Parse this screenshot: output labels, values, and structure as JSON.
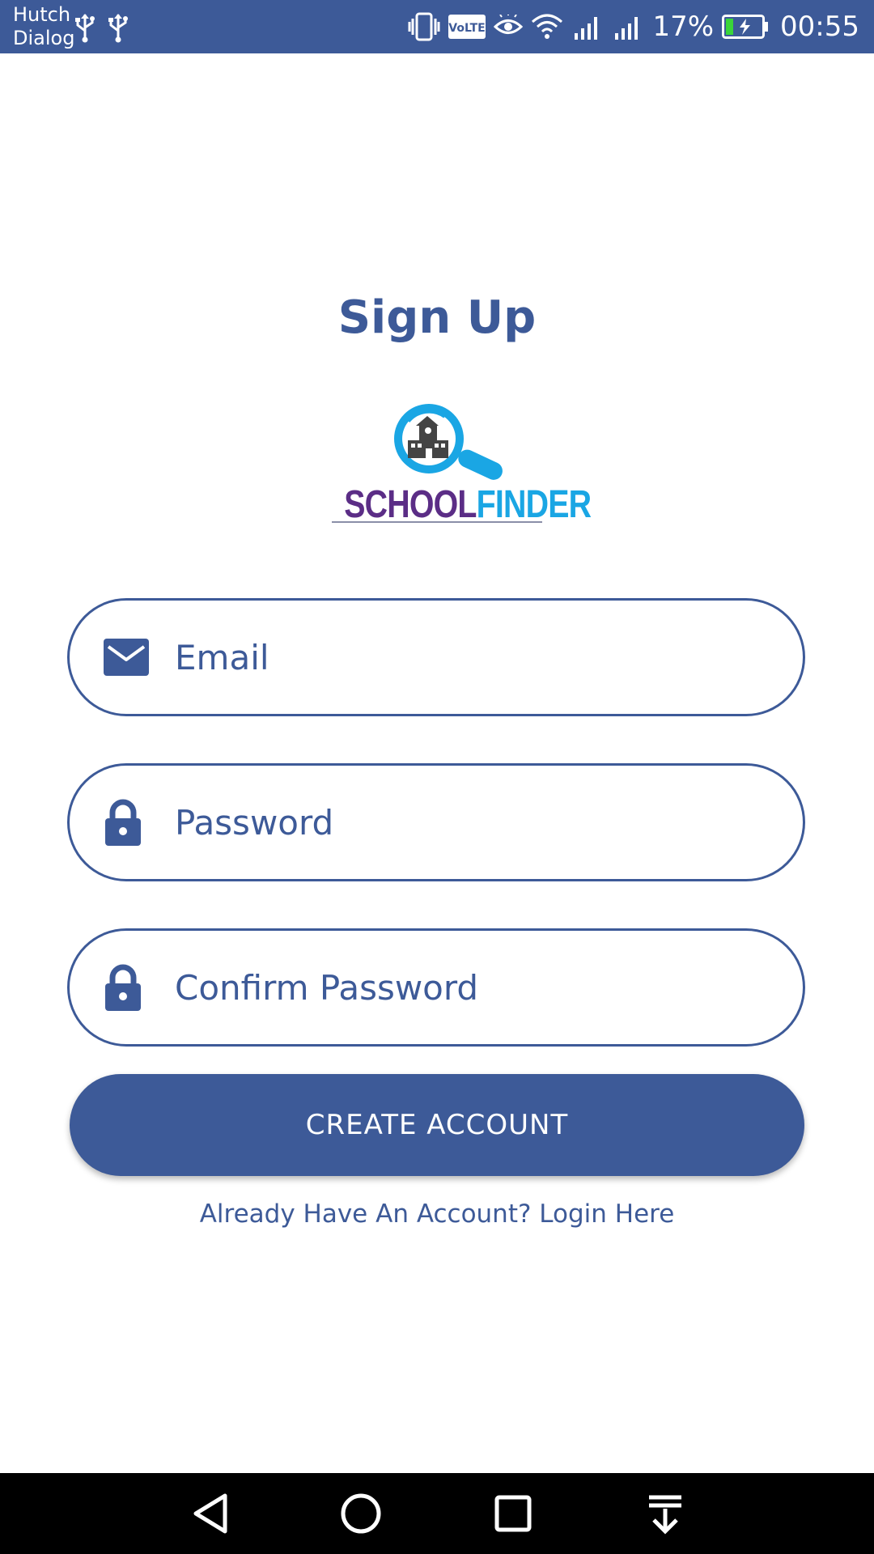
{
  "status_bar": {
    "carrier_line1": "Hutch",
    "carrier_line2": "Dialog",
    "battery_percent": "17%",
    "time": "00:55",
    "icons": [
      "usb-icon",
      "usb-icon",
      "vibrate-icon",
      "volte-icon",
      "eye-icon",
      "wifi-icon",
      "signal-icon",
      "signal-icon",
      "battery-charging-icon"
    ],
    "volte_label": "VoLTE"
  },
  "page": {
    "title": "Sign Up"
  },
  "logo": {
    "school": "SCHOOL",
    "finder": "FINDER",
    "icon": "magnifier-school-icon"
  },
  "form": {
    "email": {
      "placeholder": "Email",
      "value": "",
      "icon": "envelope-icon"
    },
    "password": {
      "placeholder": "Password",
      "value": "",
      "icon": "lock-icon"
    },
    "confirm_password": {
      "placeholder": "Confirm Password",
      "value": "",
      "icon": "lock-icon"
    },
    "submit_label": "CREATE ACCOUNT",
    "login_link": "Already Have An Account? Login Here"
  },
  "nav_bar": {
    "buttons": [
      "back-icon",
      "home-icon",
      "recents-icon",
      "notification-pull-icon"
    ]
  },
  "colors": {
    "primary": "#3d5a98",
    "logo_purple": "#5b2d86",
    "logo_blue": "#1aa6e4",
    "background": "#ffffff",
    "nav_bar": "#000000"
  }
}
